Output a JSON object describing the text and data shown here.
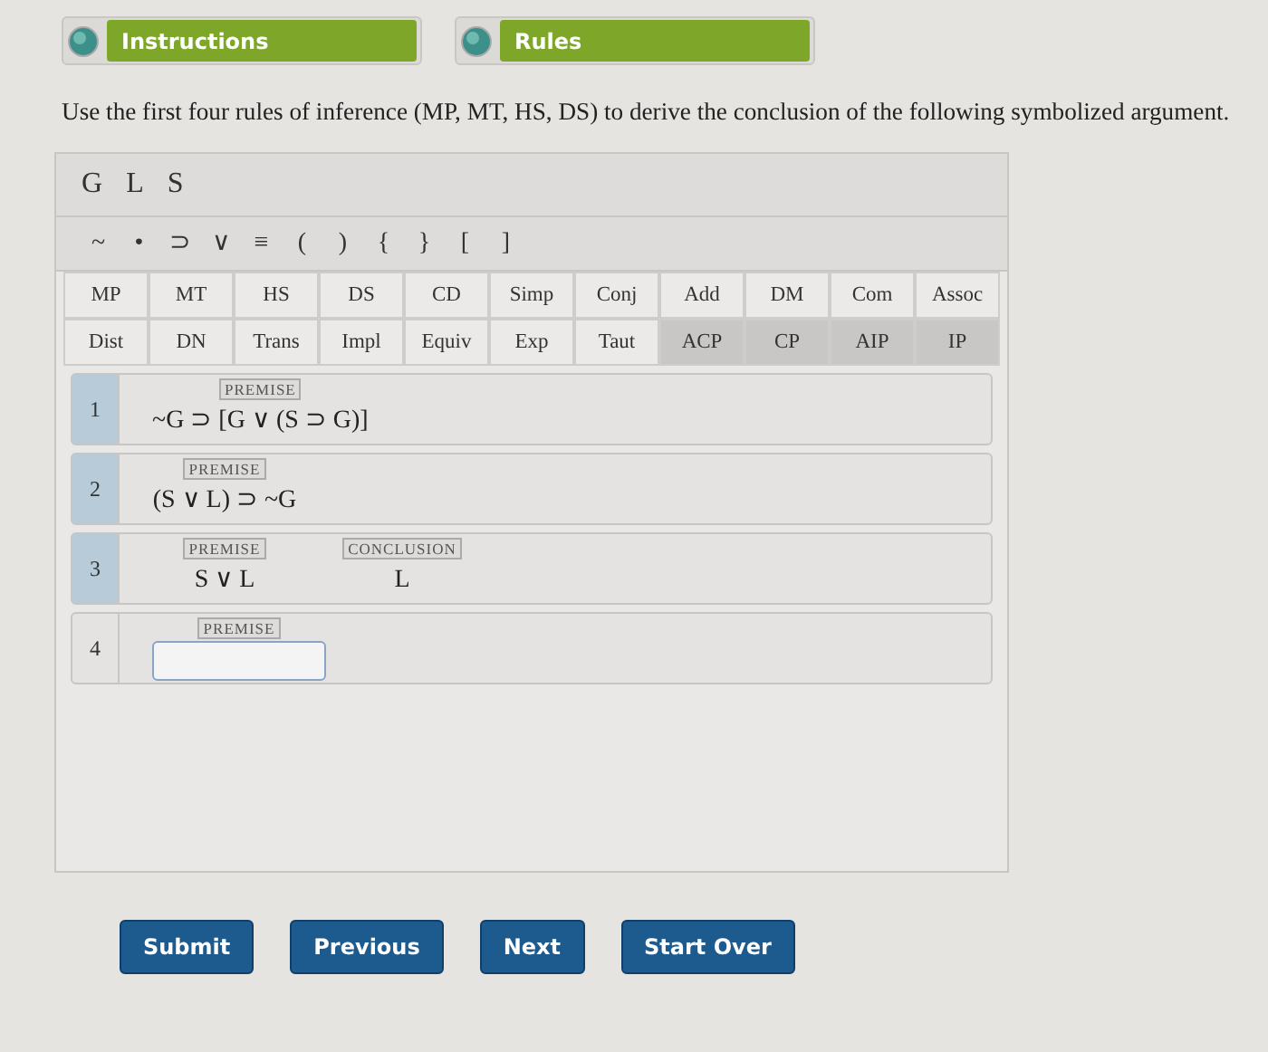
{
  "tabs": [
    {
      "label": "Instructions"
    },
    {
      "label": "Rules"
    }
  ],
  "instruction": "Use the first four rules of inference (MP, MT, HS, DS) to derive the conclusion of the following symbolized argument.",
  "letters": [
    "G",
    "L",
    "S"
  ],
  "symbols": [
    "~",
    "•",
    "⊃",
    "∨",
    "≡",
    "(",
    ")",
    "{",
    "}",
    "[",
    "]"
  ],
  "rules": [
    {
      "label": "MP",
      "shaded": false
    },
    {
      "label": "MT",
      "shaded": false
    },
    {
      "label": "HS",
      "shaded": false
    },
    {
      "label": "DS",
      "shaded": false
    },
    {
      "label": "CD",
      "shaded": false
    },
    {
      "label": "Simp",
      "shaded": false
    },
    {
      "label": "Conj",
      "shaded": false
    },
    {
      "label": "Add",
      "shaded": false
    },
    {
      "label": "DM",
      "shaded": false
    },
    {
      "label": "Com",
      "shaded": false
    },
    {
      "label": "Assoc",
      "shaded": false
    },
    {
      "label": "Dist",
      "shaded": false
    },
    {
      "label": "DN",
      "shaded": false
    },
    {
      "label": "Trans",
      "shaded": false
    },
    {
      "label": "Impl",
      "shaded": false
    },
    {
      "label": "Equiv",
      "shaded": false
    },
    {
      "label": "Exp",
      "shaded": false
    },
    {
      "label": "Taut",
      "shaded": false
    },
    {
      "label": "ACP",
      "shaded": true
    },
    {
      "label": "CP",
      "shaded": true
    },
    {
      "label": "AIP",
      "shaded": true
    },
    {
      "label": "IP",
      "shaded": true
    }
  ],
  "lines": [
    {
      "number": "1",
      "premise": true,
      "parts": [
        {
          "kind": "formula",
          "tag": "PREMISE",
          "formula": "~G ⊃ [G ∨ (S ⊃ G)]"
        }
      ]
    },
    {
      "number": "2",
      "premise": true,
      "parts": [
        {
          "kind": "formula",
          "tag": "PREMISE",
          "formula": "(S ∨ L) ⊃ ~G"
        }
      ]
    },
    {
      "number": "3",
      "premise": true,
      "parts": [
        {
          "kind": "formula",
          "tag": "PREMISE",
          "formula": "S ∨ L"
        },
        {
          "kind": "formula",
          "tag": "CONCLUSION",
          "formula": "L"
        }
      ]
    },
    {
      "number": "4",
      "premise": false,
      "parts": [
        {
          "kind": "field",
          "tag": "PREMISE"
        }
      ]
    }
  ],
  "buttons": [
    "Submit",
    "Previous",
    "Next",
    "Start Over"
  ]
}
